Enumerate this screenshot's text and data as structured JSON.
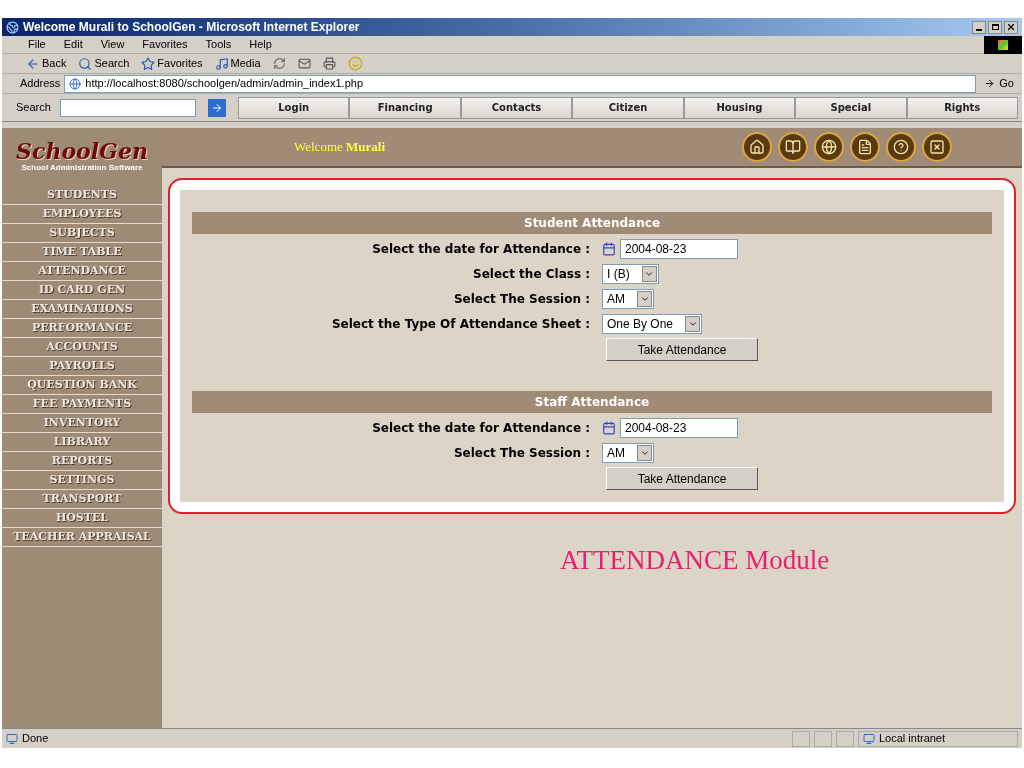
{
  "window": {
    "title": "Welcome Murali to SchoolGen - Microsoft Internet Explorer"
  },
  "menu": [
    "File",
    "Edit",
    "View",
    "Favorites",
    "Tools",
    "Help"
  ],
  "toolbar": [
    {
      "kind": "back",
      "label": "Back"
    },
    {
      "kind": "search",
      "label": "Search"
    },
    {
      "kind": "favorites",
      "label": "Favorites"
    },
    {
      "kind": "media",
      "label": "Media"
    }
  ],
  "address": {
    "label": "Address",
    "url": "http://localhost:8080/schoolgen/admin/admin_index1.php",
    "go": "Go"
  },
  "links_bar": {
    "search_label": "Search",
    "tabs": [
      "Login",
      "Financing",
      "Contacts",
      "Citizen",
      "Housing",
      "Special",
      "Rights"
    ]
  },
  "app": {
    "logo": "SchoolGen",
    "subtitle": "School Administration Software",
    "welcome": "Welcome **Murali**"
  },
  "nav": [
    {
      "label": "STUDENTS",
      "selected": false
    },
    {
      "label": "EMPLOYEES",
      "selected": false
    },
    {
      "label": "SUBJECTS",
      "selected": false
    },
    {
      "label": "TIME TABLE",
      "selected": false
    },
    {
      "label": "ATTENDANCE",
      "selected": false
    },
    {
      "label": "ID CARD GEN",
      "selected": false
    },
    {
      "label": "EXAMINATIONS",
      "selected": false
    },
    {
      "label": "PERFORMANCE",
      "selected": false
    },
    {
      "label": "ACCOUNTS",
      "selected": false
    },
    {
      "label": "PAYROLLS",
      "selected": false
    },
    {
      "label": "QUESTION BANK",
      "selected": false
    },
    {
      "label": "FEE PAYMENTS",
      "selected": false
    },
    {
      "label": "INVENTORY",
      "selected": false
    },
    {
      "label": "LIBRARY",
      "selected": false
    },
    {
      "label": "REPORTS",
      "selected": false
    },
    {
      "label": "SETTINGS",
      "selected": false
    },
    {
      "label": "TRANSPORT",
      "selected": false
    },
    {
      "label": "HOSTEL",
      "selected": false
    },
    {
      "label": "TEACHER APPRAISAL",
      "selected": false
    }
  ],
  "sections": [
    {
      "title": "Student Attendance",
      "fields": [
        {
          "kind": "date",
          "label": "Select the date for Attendance :",
          "value": "2004-08-23"
        },
        {
          "kind": "select",
          "label": "Select the Class :",
          "value": "I (B)"
        },
        {
          "kind": "select",
          "label": "Select The Session :",
          "value": "AM"
        },
        {
          "kind": "select",
          "label": "Select the Type Of Attendance Sheet :",
          "value": "One By One"
        }
      ],
      "button": "Take Attendance"
    },
    {
      "title": "Staff Attendance",
      "fields": [
        {
          "kind": "date",
          "label": "Select the date for Attendance :",
          "value": "2004-08-23"
        },
        {
          "kind": "select",
          "label": "Select The Session :",
          "value": "AM"
        }
      ],
      "button": "Take Attendance"
    }
  ],
  "caption": "ATTENDANCE Module",
  "status_bar": {
    "text": "Done",
    "zone": "Local intranet"
  }
}
